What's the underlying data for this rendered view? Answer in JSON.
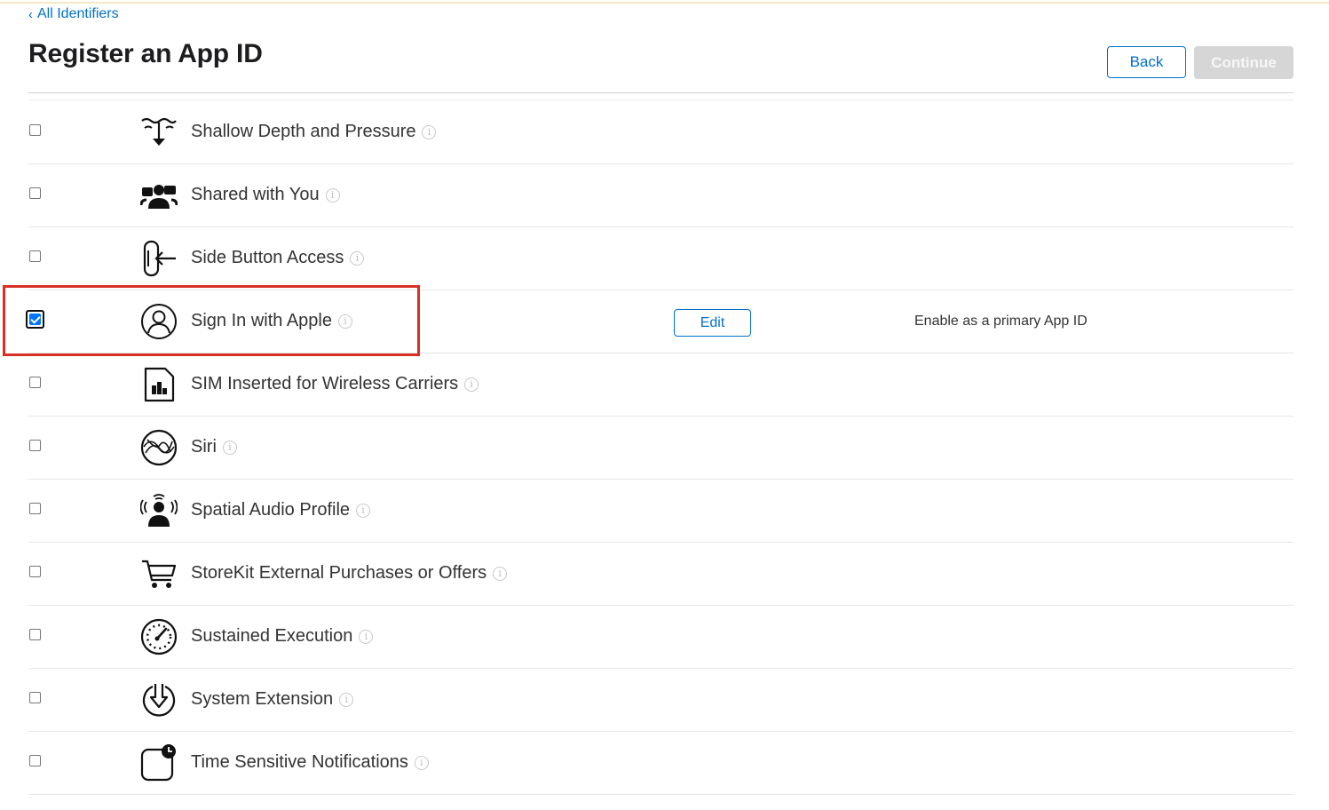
{
  "breadcrumb": {
    "label": "All Identifiers"
  },
  "page": {
    "title": "Register an App ID"
  },
  "actions": {
    "back": "Back",
    "continue": "Continue"
  },
  "capabilities": [
    {
      "name": "Shallow Depth and Pressure",
      "icon": "depth-pressure-icon",
      "checked": false
    },
    {
      "name": "Shared with You",
      "icon": "shared-people-icon",
      "checked": false
    },
    {
      "name": "Side Button Access",
      "icon": "side-button-icon",
      "checked": false
    },
    {
      "name": "Sign In with Apple",
      "icon": "person-circle-icon",
      "checked": true,
      "edit": "Edit",
      "note": "Enable as a primary App ID"
    },
    {
      "name": "SIM Inserted for Wireless Carriers",
      "icon": "sim-card-icon",
      "checked": false
    },
    {
      "name": "Siri",
      "icon": "siri-icon",
      "checked": false
    },
    {
      "name": "Spatial Audio Profile",
      "icon": "spatial-audio-icon",
      "checked": false
    },
    {
      "name": "StoreKit External Purchases or Offers",
      "icon": "shopping-cart-icon",
      "checked": false
    },
    {
      "name": "Sustained Execution",
      "icon": "gauge-icon",
      "checked": false
    },
    {
      "name": "System Extension",
      "icon": "download-circle-icon",
      "checked": false
    },
    {
      "name": "Time Sensitive Notifications",
      "icon": "time-sensitive-icon",
      "checked": false
    }
  ],
  "info_glyph": "i",
  "colors": {
    "accent": "#0070c9",
    "highlight": "#d93025",
    "checkbox_checked": "#0075ff"
  }
}
